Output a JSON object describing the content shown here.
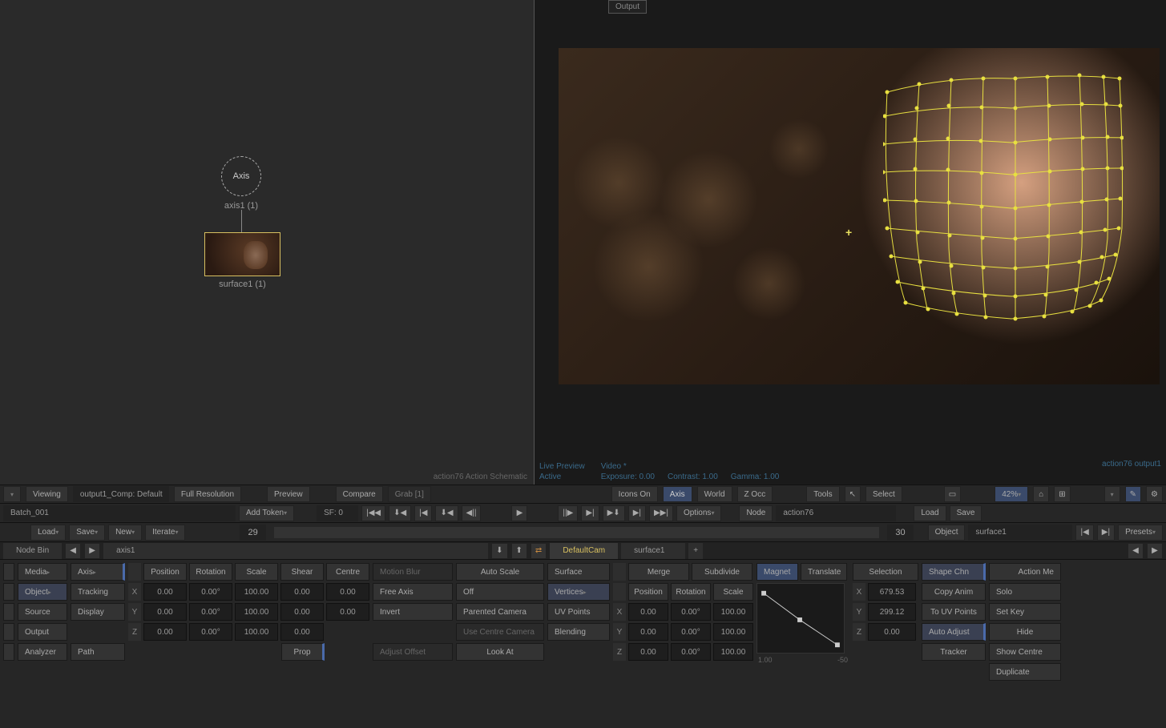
{
  "schematic": {
    "axis_node": "Axis",
    "axis_label": "axis1 (1)",
    "surface_label": "surface1 (1)",
    "footer": "action76 Action Schematic"
  },
  "viewer": {
    "output_tab": "Output",
    "live_preview": "Live Preview",
    "active": "Active",
    "video": "Video *",
    "exposure": "Exposure: 0.00",
    "contrast": "Contrast: 1.00",
    "gamma": "Gamma: 1.00",
    "output_label": "action76 output1"
  },
  "toolbar": {
    "viewing": "Viewing",
    "comp": "output1_Comp: Default",
    "full_res": "Full Resolution",
    "preview": "Preview",
    "compare": "Compare",
    "grab": "Grab [1]",
    "icons_on": "Icons On",
    "axis": "Axis",
    "world": "World",
    "z_occ": "Z Occ",
    "tools": "Tools",
    "select": "Select",
    "zoom": "42%"
  },
  "row2": {
    "batch": "Batch_001",
    "add_token": "Add Token",
    "sf": "SF: 0",
    "options": "Options",
    "node_lbl": "Node",
    "node_val": "action76",
    "load": "Load",
    "save": "Save",
    "frame_cur": "29",
    "frame_end": "30"
  },
  "row3": {
    "load": "Load",
    "save": "Save",
    "new": "New",
    "iterate": "Iterate",
    "object_lbl": "Object",
    "object_val": "surface1",
    "presets": "Presets"
  },
  "tabs": {
    "node_bin": "Node Bin",
    "axis1": "axis1",
    "default_cam": "DefaultCam",
    "surface1": "surface1"
  },
  "props": {
    "left_side": [
      "Media",
      "Object",
      "Source",
      "Output",
      "Analyzer"
    ],
    "axis_menu": [
      "Axis",
      "Tracking",
      "Display",
      "",
      "Path"
    ],
    "headers1": [
      "Position",
      "Rotation",
      "Scale",
      "Shear",
      "Centre"
    ],
    "x": [
      "0.00",
      "0.00°",
      "100.00",
      "0.00",
      "0.00"
    ],
    "y": [
      "0.00",
      "0.00°",
      "100.00",
      "0.00",
      "0.00"
    ],
    "z": [
      "0.00",
      "0.00°",
      "100.00",
      "0.00"
    ],
    "prop": "Prop",
    "col_motion": [
      "Motion Blur",
      "Free Axis",
      "Invert",
      "",
      "Adjust Offset"
    ],
    "col_auto": [
      "Auto Scale",
      "Off",
      "Parented Camera",
      "Use Centre Camera",
      "Look At"
    ],
    "surface": "Surface",
    "vertices": "Vertices",
    "uv_points": "UV Points",
    "blending": "Blending",
    "merge": "Merge",
    "subdivide": "Subdivide",
    "prs": [
      "Position",
      "Rotation",
      "Scale"
    ],
    "surf_x": [
      "0.00",
      "0.00°",
      "100.00"
    ],
    "surf_y": [
      "0.00",
      "0.00°",
      "100.00"
    ],
    "surf_z": [
      "0.00",
      "0.00°",
      "100.00"
    ],
    "magnet": "Magnet",
    "translate": "Translate",
    "selection": "Selection",
    "copy_anim": "Copy Anim",
    "to_uv": "To UV Points",
    "tracker": "Tracker",
    "shape_chn": "Shape Chn",
    "auto_adjust": "Auto Adjust",
    "vtx_x": "679.53",
    "vtx_y": "299.12",
    "vtx_z": "0.00",
    "right_header": "Action Me",
    "solo": "Solo",
    "set_key": "Set Key",
    "hide": "Hide",
    "show_centre": "Show Centre",
    "duplicate": "Duplicate",
    "curve_left": "1.00",
    "curve_right": "-50"
  }
}
